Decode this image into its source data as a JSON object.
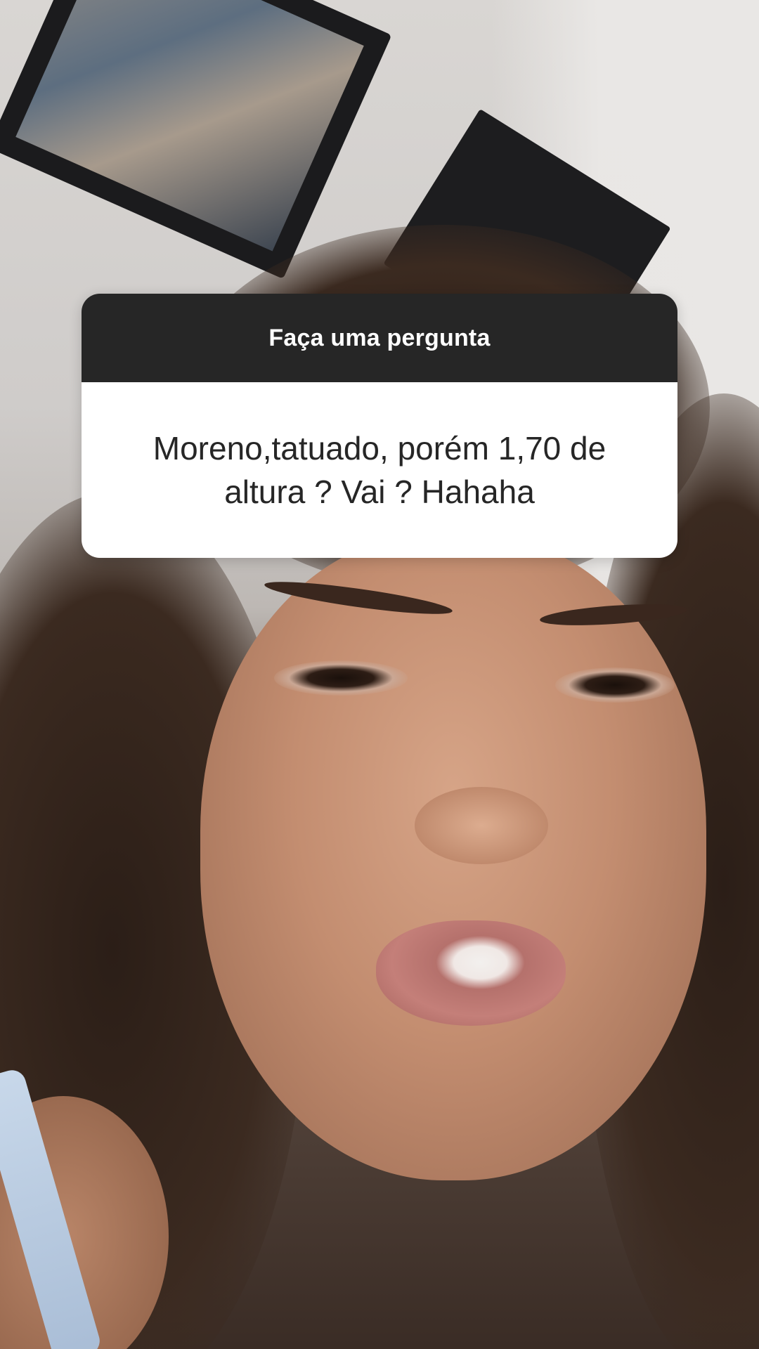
{
  "story": {
    "background_description_icon": "photo-background",
    "question_sticker": {
      "header": "Faça uma pergunta",
      "question": "Moreno,tatuado, porém 1,70 de altura ? Vai ? Hahaha"
    }
  },
  "colors": {
    "sticker_header_bg": "#262626",
    "sticker_body_bg": "#ffffff",
    "sticker_text": "#262626"
  }
}
